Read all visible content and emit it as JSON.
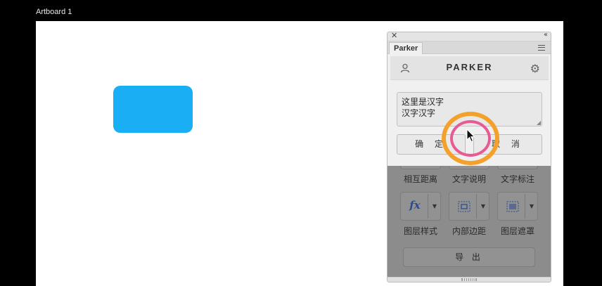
{
  "artboard": {
    "label": "Artboard 1",
    "shape_color": "#1aaef4"
  },
  "panel": {
    "tab_label": "Parker",
    "logo_text": "PARKER",
    "textarea_value": "这里是汉字\n汉字汉字",
    "ok_label": "确 定",
    "cancel_label": "取 消",
    "tools_row1": [
      "相互距离",
      "文字说明",
      "文字标注"
    ],
    "tools_row2": [
      "图层样式",
      "内部边距",
      "图层遮罩"
    ],
    "fx_icon_text": "fx",
    "export_label": "导 出"
  },
  "icons": {
    "close": "close-icon",
    "collapse": "collapse-icon",
    "menu": "hamburger-menu-icon",
    "user": "user-icon",
    "settings": "gear-icon"
  },
  "colors": {
    "cursor_ring_outer": "#f4a12c",
    "cursor_ring_inner": "#e85a93"
  }
}
